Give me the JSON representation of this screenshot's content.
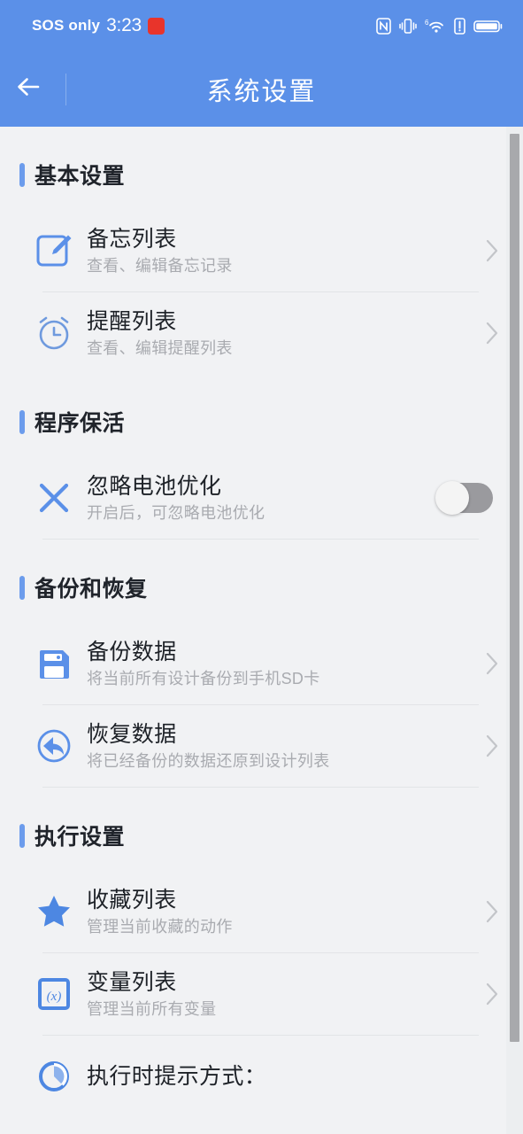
{
  "statusbar": {
    "carrier": "SOS only",
    "time": "3:23",
    "app_badge_label": "",
    "icons": [
      "nfc-icon",
      "vibrate-icon",
      "wifi-6-icon",
      "signal-alert-icon",
      "battery-icon"
    ]
  },
  "appbar": {
    "back_icon": "back-arrow-icon",
    "title": "系统设置"
  },
  "sections": [
    {
      "title": "基本设置",
      "rows": [
        {
          "icon": "edit-note-icon",
          "title": "备忘列表",
          "subtitle": "查看、编辑备忘记录",
          "accessory": "chevron"
        },
        {
          "icon": "alarm-clock-icon",
          "title": "提醒列表",
          "subtitle": "查看、编辑提醒列表",
          "accessory": "chevron"
        }
      ]
    },
    {
      "title": "程序保活",
      "rows": [
        {
          "icon": "cross-icon",
          "title": "忽略电池优化",
          "subtitle": "开启后，可忽略电池优化",
          "accessory": "toggle",
          "toggle_on": false
        }
      ]
    },
    {
      "title": "备份和恢复",
      "rows": [
        {
          "icon": "floppy-disk-icon",
          "title": "备份数据",
          "subtitle": "将当前所有设计备份到手机SD卡",
          "accessory": "chevron"
        },
        {
          "icon": "restore-arrow-icon",
          "title": "恢复数据",
          "subtitle": "将已经备份的数据还原到设计列表",
          "accessory": "chevron"
        }
      ]
    },
    {
      "title": "执行设置",
      "rows": [
        {
          "icon": "star-icon",
          "title": "收藏列表",
          "subtitle": "管理当前收藏的动作",
          "accessory": "chevron"
        },
        {
          "icon": "variable-icon",
          "title": "变量列表",
          "subtitle": "管理当前所有变量",
          "accessory": "chevron"
        },
        {
          "icon": "gauge-icon",
          "title": "执行时提示方式：",
          "subtitle": "",
          "accessory": "none"
        }
      ]
    }
  ],
  "colors": {
    "header_blue": "#5b90e8",
    "accent_blue": "#6c9cec",
    "icon_blue": "#5b90e8",
    "page_bg": "#f1f2f4",
    "title_text": "#1d2127",
    "sub_text": "#a9abb0",
    "toggle_off_track": "#9a9a9e"
  }
}
